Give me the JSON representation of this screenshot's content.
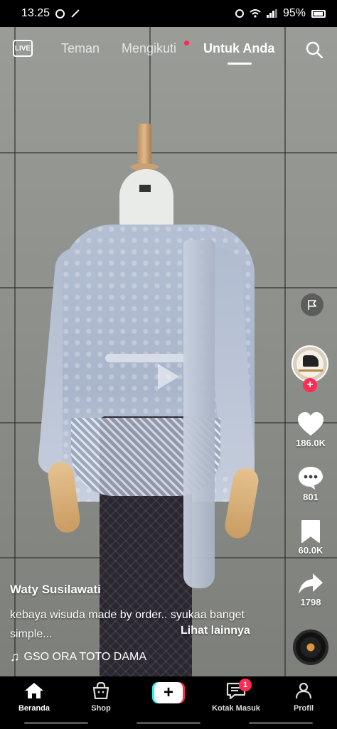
{
  "status_bar": {
    "time": "13.25",
    "battery": "95%"
  },
  "top_nav": {
    "live_label": "LIVE",
    "tabs": [
      {
        "label": "Teman"
      },
      {
        "label": "Mengikuti"
      },
      {
        "label": "Untuk Anda"
      }
    ]
  },
  "side_actions": {
    "likes": "186.0K",
    "comments": "801",
    "saves": "60.0K",
    "shares": "1798"
  },
  "video_info": {
    "username": "Waty Susilawati",
    "caption": "kebaya wisuda made by order..  syukaa banget simple...",
    "see_more": "Lihat lainnya",
    "sound": "GSO ORA TOTO DAMA"
  },
  "bottom_nav": {
    "items": [
      {
        "label": "Beranda"
      },
      {
        "label": "Shop"
      },
      {
        "label": "+"
      },
      {
        "label": "Kotak Masuk"
      },
      {
        "label": "Profil"
      }
    ],
    "inbox_badge": "1"
  },
  "colors": {
    "accent": "#fe2c55",
    "cyan": "#25f4ee",
    "background": "#000000"
  }
}
